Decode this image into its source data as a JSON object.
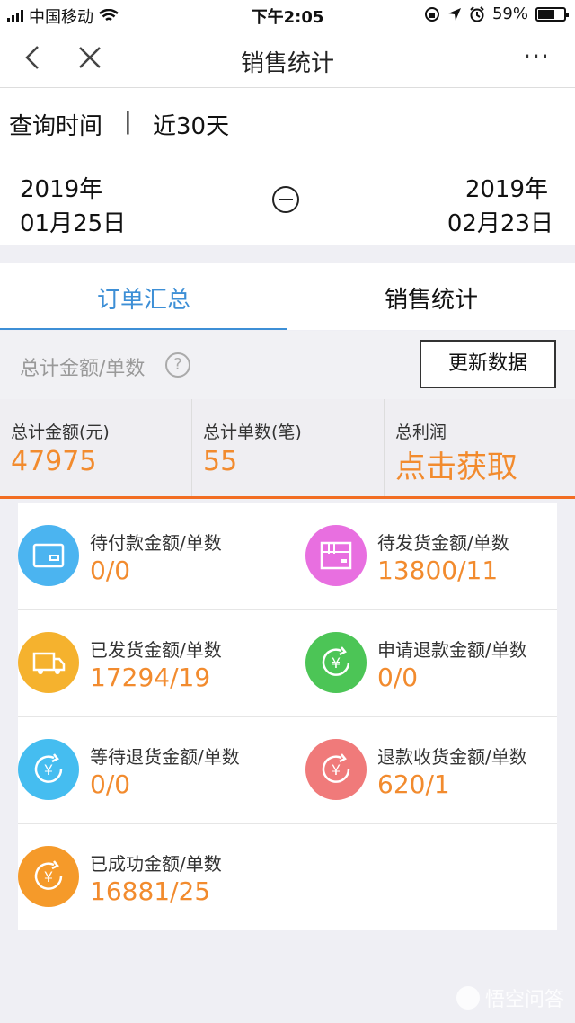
{
  "statusbar": {
    "carrier": "中国移动",
    "time": "下午2:05",
    "battery": "59%",
    "battery_level": 0.59
  },
  "navbar": {
    "title": "销售统计",
    "more": "···"
  },
  "query": {
    "label": "查询时间",
    "separator": "|",
    "value": "近30天"
  },
  "dates": {
    "start_year": "2019年",
    "start_day": "01月25日",
    "end_year": "2019年",
    "end_day": "02月23日"
  },
  "tabs": [
    {
      "label": "订单汇总"
    },
    {
      "label": "销售统计"
    }
  ],
  "summary": {
    "label": "总计金额/单数",
    "help": "?",
    "refresh_label": "更新数据"
  },
  "totals": [
    {
      "label": "总计金额(元)",
      "value": "47975"
    },
    {
      "label": "总计单数(笔)",
      "value": "55"
    },
    {
      "label": "总利润",
      "value": "点击获取"
    }
  ],
  "items": [
    {
      "label": "待付款金额/单数",
      "value": "0/0",
      "icon": "card-icon",
      "color": "#4bb4f0"
    },
    {
      "label": "待发货金额/单数",
      "value": "13800/11",
      "icon": "package-icon",
      "color": "#e86fe0"
    },
    {
      "label": "已发货金额/单数",
      "value": "17294/19",
      "icon": "truck-icon",
      "color": "#f5b22e"
    },
    {
      "label": "申请退款金额/单数",
      "value": "0/0",
      "icon": "refund-icon",
      "color": "#4cc556"
    },
    {
      "label": "等待退货金额/单数",
      "value": "0/0",
      "icon": "return-icon",
      "color": "#45bdf0"
    },
    {
      "label": "退款收货金额/单数",
      "value": "620/1",
      "icon": "refund-receive-icon",
      "color": "#f07a7a"
    },
    {
      "label": "已成功金额/单数",
      "value": "16881/25",
      "icon": "success-icon",
      "color": "#f59a2a"
    }
  ],
  "watermark": {
    "text": "悟空问答"
  }
}
